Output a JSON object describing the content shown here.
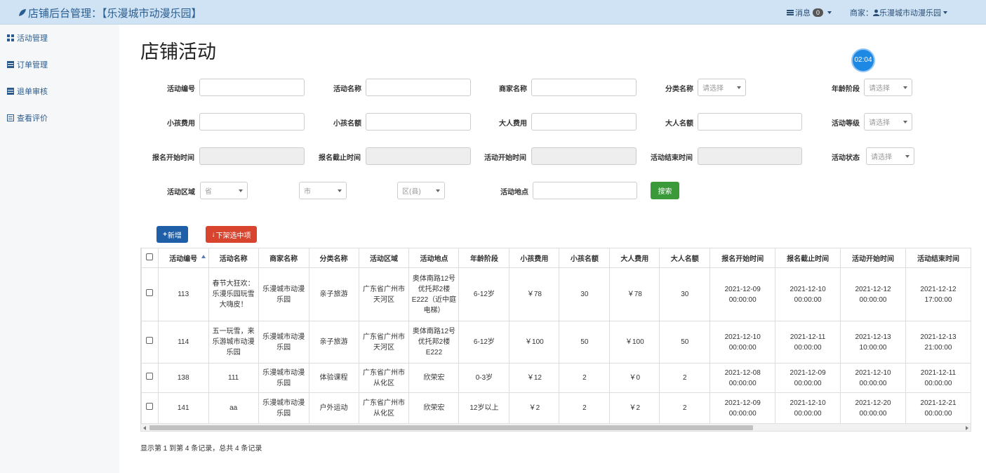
{
  "header": {
    "brand": "店铺后台管理：【乐漫城市动漫乐园】",
    "messages_label": "消息",
    "messages_count": "0",
    "merchant_prefix": "商家：",
    "merchant_name": "乐漫城市动漫乐园"
  },
  "sidebar": {
    "items": [
      {
        "label": "活动管理"
      },
      {
        "label": "订单管理"
      },
      {
        "label": "退单审核"
      },
      {
        "label": "查看评价"
      }
    ]
  },
  "page": {
    "title": "店铺活动",
    "timer": "02:04"
  },
  "filters": {
    "activity_id": "活动编号",
    "activity_name": "活动名称",
    "merchant_name": "商家名称",
    "category_name": "分类名称",
    "age_stage": "年龄阶段",
    "child_fee": "小孩费用",
    "child_quota": "小孩名额",
    "adult_fee": "大人费用",
    "adult_quota": "大人名额",
    "activity_level": "活动等级",
    "signup_start": "报名开始时间",
    "signup_end": "报名截止时间",
    "activity_start": "活动开始时间",
    "activity_end": "活动结束时间",
    "activity_status": "活动状态",
    "activity_region": "活动区域",
    "activity_place": "活动地点",
    "select_placeholder": "请选择",
    "province": "省",
    "city": "市",
    "district": "区(县)"
  },
  "buttons": {
    "search": "搜索",
    "add": "新增",
    "download": "下架选中项"
  },
  "table": {
    "columns": [
      "活动编号",
      "活动名称",
      "商家名称",
      "分类名称",
      "活动区域",
      "活动地点",
      "年龄阶段",
      "小孩费用",
      "小孩名额",
      "大人费用",
      "大人名额",
      "报名开始时间",
      "报名截止时间",
      "活动开始时间",
      "活动结束时间"
    ],
    "rows": [
      [
        "113",
        "春节大狂欢：乐漫乐园玩雪大嗨皮！",
        "乐漫城市动漫乐园",
        "亲子旅游",
        "广东省广州市天河区",
        "奥体南路12号优托邦2楼E222（近中庭电梯）",
        "6-12岁",
        "￥78",
        "30",
        "￥78",
        "30",
        "2021-12-09 00:00:00",
        "2021-12-10 00:00:00",
        "2021-12-12 00:00:00",
        "2021-12-12 17:00:00"
      ],
      [
        "114",
        "五一玩雪，来乐游城市动漫乐园",
        "乐漫城市动漫乐园",
        "亲子旅游",
        "广东省广州市天河区",
        "奥体南路12号优托邦2楼E222",
        "6-12岁",
        "￥100",
        "50",
        "￥100",
        "50",
        "2021-12-10 00:00:00",
        "2021-12-11 00:00:00",
        "2021-12-13 10:00:00",
        "2021-12-13 21:00:00"
      ],
      [
        "138",
        "111",
        "乐漫城市动漫乐园",
        "体验课程",
        "广东省广州市从化区",
        "欣荣宏",
        "0-3岁",
        "￥12",
        "2",
        "￥0",
        "2",
        "2021-12-08 00:00:00",
        "2021-12-09 00:00:00",
        "2021-12-10 00:00:00",
        "2021-12-11 00:00:00"
      ],
      [
        "141",
        "aa",
        "乐漫城市动漫乐园",
        "户外运动",
        "广东省广州市从化区",
        "欣荣宏",
        "12岁以上",
        "￥2",
        "2",
        "￥2",
        "2",
        "2021-12-09 00:00:00",
        "2021-12-10 00:00:00",
        "2021-12-20 00:00:00",
        "2021-12-21 00:00:00"
      ]
    ]
  },
  "footer": {
    "info": "显示第 1 到第 4 条记录，总共 4 条记录"
  },
  "colors": {
    "topbar": "#cfe3f4",
    "primary": "#1f5fa8",
    "success": "#3a9a3a",
    "danger": "#d9442f"
  }
}
